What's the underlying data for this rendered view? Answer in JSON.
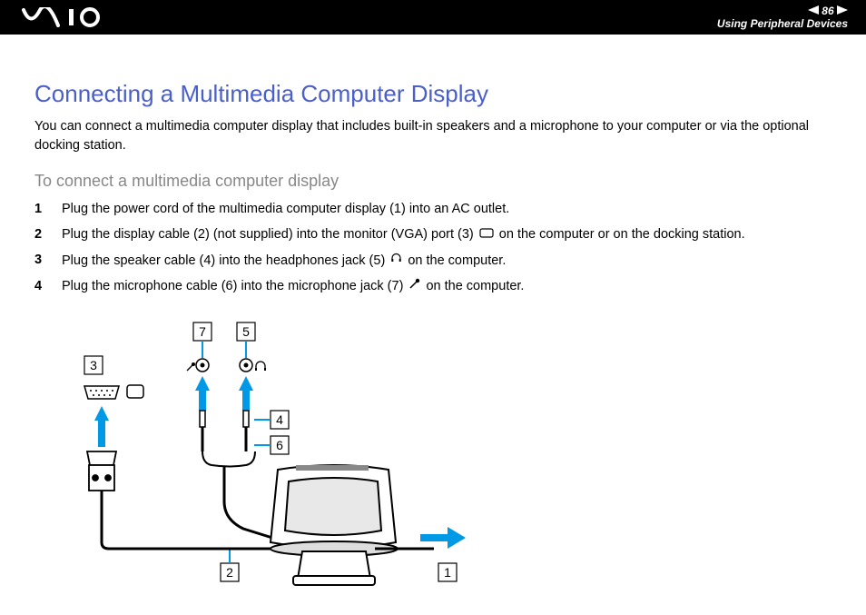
{
  "header": {
    "page_number": "86",
    "section": "Using Peripheral Devices"
  },
  "title": "Connecting a Multimedia Computer Display",
  "intro": "You can connect a multimedia computer display that includes built-in speakers and a microphone to your computer or via the optional docking station.",
  "subtitle": "To connect a multimedia computer display",
  "steps": [
    "Plug the power cord of the multimedia computer display (1) into an AC outlet.",
    "Plug the display cable (2) (not supplied) into the monitor (VGA) port (3) ▢ on the computer or on the docking station.",
    "Plug the speaker cable (4) into the headphones jack (5) ♫ on the computer.",
    "Plug the microphone cable (6) into the microphone jack (7) 🎤 on the computer."
  ],
  "diagram_labels": {
    "1": "1",
    "2": "2",
    "3": "3",
    "4": "4",
    "5": "5",
    "6": "6",
    "7": "7"
  }
}
